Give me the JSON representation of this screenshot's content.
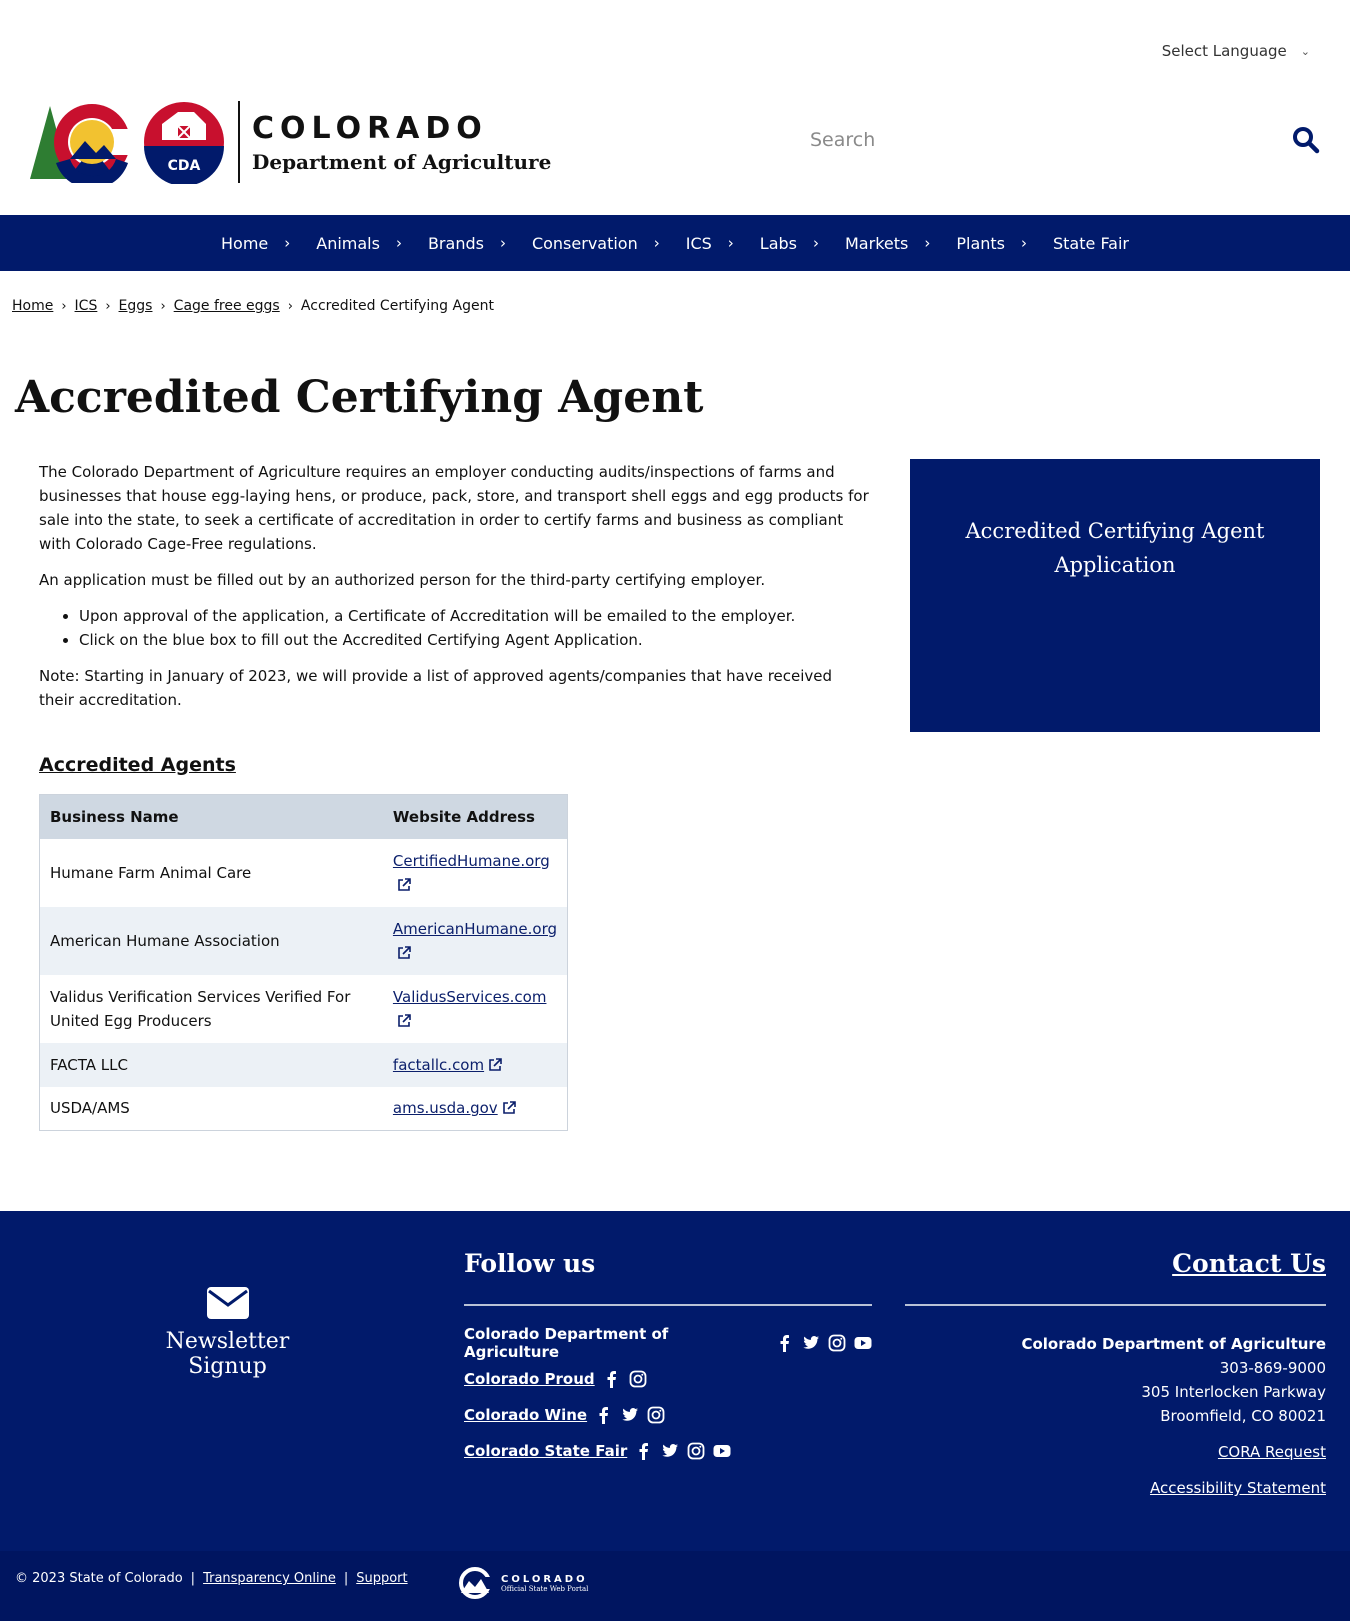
{
  "header": {
    "language_label": "Select Language",
    "logo_word_top": "COLORADO",
    "logo_word_bottom": "Department of Agriculture",
    "logo_badge": "CDA",
    "search_placeholder": "Search"
  },
  "nav": {
    "items": [
      {
        "label": "Home"
      },
      {
        "label": "Animals"
      },
      {
        "label": "Brands"
      },
      {
        "label": "Conservation"
      },
      {
        "label": "ICS"
      },
      {
        "label": "Labs"
      },
      {
        "label": "Markets"
      },
      {
        "label": "Plants"
      },
      {
        "label": "State Fair"
      }
    ]
  },
  "breadcrumb": {
    "items": [
      "Home",
      "ICS",
      "Eggs",
      "Cage free eggs"
    ],
    "current": "Accredited Certifying Agent"
  },
  "page": {
    "title": "Accredited Certifying Agent",
    "para1": "The Colorado Department of Agriculture requires an employer conducting audits/inspections of farms and businesses that house egg-laying hens, or produce, pack, store, and transport shell eggs and egg products for sale into the state, to seek a certificate of accreditation in order to certify farms and business as compliant with Colorado Cage-Free regulations.",
    "para2": "An application must be filled out by an authorized person for the third-party certifying employer.",
    "bullets": [
      "Upon approval of the application, a Certificate of Accreditation will be emailed to the employer.",
      "Click on the blue box to fill out the Accredited Certifying Agent Application."
    ],
    "note": "Note: Starting in January of 2023, we will provide a list of approved agents/companies that have received their accreditation.",
    "bluebox_label": "Accredited Certifying Agent Application",
    "agents_heading": "Accredited Agents"
  },
  "table": {
    "headers": [
      "Business Name",
      "Website Address"
    ],
    "rows": [
      {
        "name": "Humane Farm Animal Care",
        "site": "CertifiedHumane.org"
      },
      {
        "name": "American Humane Association",
        "site": "AmericanHumane.org"
      },
      {
        "name": "Validus Verification Services Verified For United Egg Producers",
        "site": "ValidusServices.com"
      },
      {
        "name": "FACTA LLC",
        "site": "factallc.com"
      },
      {
        "name": "USDA/AMS",
        "site": "ams.usda.gov"
      }
    ]
  },
  "footer": {
    "newsletter_label": "Newsletter Signup",
    "follow_heading": "Follow us",
    "follow_rows": [
      {
        "label": "Colorado Department of Agriculture",
        "icons": [
          "facebook-icon",
          "twitter-icon",
          "instagram-icon",
          "youtube-icon"
        ]
      },
      {
        "label": "Colorado Proud",
        "icons": [
          "facebook-icon",
          "instagram-icon"
        ]
      },
      {
        "label": "Colorado Wine",
        "icons": [
          "facebook-icon",
          "twitter-icon",
          "instagram-icon"
        ]
      },
      {
        "label": "Colorado State Fair",
        "icons": [
          "facebook-icon",
          "twitter-icon",
          "instagram-icon",
          "youtube-icon"
        ]
      }
    ],
    "contact_heading": "Contact Us",
    "contact_org": "Colorado Department of Agriculture",
    "contact_phone": "303-869-9000",
    "contact_address1": "305 Interlocken Parkway",
    "contact_address2": "Broomfield, CO 80021",
    "cora_link": "CORA Request",
    "accessibility_link": "Accessibility Statement"
  },
  "bottom": {
    "copyright": "© 2023 State of Colorado",
    "sep": "|",
    "transparency_link": "Transparency Online",
    "support_link": "Support",
    "portal_title": "COLORADO",
    "portal_sub": "Official State Web Portal"
  },
  "colors": {
    "brand_blue": "#011a6b",
    "table_header": "#cfd8e2",
    "table_stripe": "#ecf1f6"
  }
}
